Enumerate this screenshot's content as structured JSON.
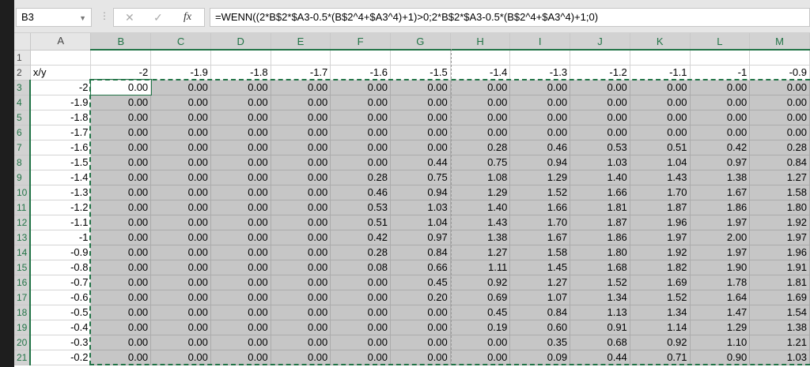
{
  "name_box": "B3",
  "formula": "=WENN((2*B$2*$A3-0.5*(B$2^4+$A3^4)+1)>0;2*B$2*$A3-0.5*(B$2^4+$A3^4)+1;0)",
  "columns": [
    "A",
    "B",
    "C",
    "D",
    "E",
    "F",
    "G",
    "H",
    "I",
    "J",
    "K",
    "L",
    "M"
  ],
  "row1": {
    "num": "1"
  },
  "row2": {
    "num": "2",
    "label": "x/y",
    "y_values": [
      "-2",
      "-1.9",
      "-1.8",
      "-1.7",
      "-1.6",
      "-1.5",
      "-1.4",
      "-1.3",
      "-1.2",
      "-1.1",
      "-1",
      "-0.9"
    ]
  },
  "rows": [
    {
      "num": "3",
      "x": "-2",
      "v": [
        "0.00",
        "0.00",
        "0.00",
        "0.00",
        "0.00",
        "0.00",
        "0.00",
        "0.00",
        "0.00",
        "0.00",
        "0.00",
        "0.00"
      ]
    },
    {
      "num": "4",
      "x": "-1.9",
      "v": [
        "0.00",
        "0.00",
        "0.00",
        "0.00",
        "0.00",
        "0.00",
        "0.00",
        "0.00",
        "0.00",
        "0.00",
        "0.00",
        "0.00"
      ]
    },
    {
      "num": "5",
      "x": "-1.8",
      "v": [
        "0.00",
        "0.00",
        "0.00",
        "0.00",
        "0.00",
        "0.00",
        "0.00",
        "0.00",
        "0.00",
        "0.00",
        "0.00",
        "0.00"
      ]
    },
    {
      "num": "6",
      "x": "-1.7",
      "v": [
        "0.00",
        "0.00",
        "0.00",
        "0.00",
        "0.00",
        "0.00",
        "0.00",
        "0.00",
        "0.00",
        "0.00",
        "0.00",
        "0.00"
      ]
    },
    {
      "num": "7",
      "x": "-1.6",
      "v": [
        "0.00",
        "0.00",
        "0.00",
        "0.00",
        "0.00",
        "0.00",
        "0.28",
        "0.46",
        "0.53",
        "0.51",
        "0.42",
        "0.28"
      ]
    },
    {
      "num": "8",
      "x": "-1.5",
      "v": [
        "0.00",
        "0.00",
        "0.00",
        "0.00",
        "0.00",
        "0.44",
        "0.75",
        "0.94",
        "1.03",
        "1.04",
        "0.97",
        "0.84"
      ]
    },
    {
      "num": "9",
      "x": "-1.4",
      "v": [
        "0.00",
        "0.00",
        "0.00",
        "0.00",
        "0.28",
        "0.75",
        "1.08",
        "1.29",
        "1.40",
        "1.43",
        "1.38",
        "1.27"
      ]
    },
    {
      "num": "10",
      "x": "-1.3",
      "v": [
        "0.00",
        "0.00",
        "0.00",
        "0.00",
        "0.46",
        "0.94",
        "1.29",
        "1.52",
        "1.66",
        "1.70",
        "1.67",
        "1.58"
      ]
    },
    {
      "num": "11",
      "x": "-1.2",
      "v": [
        "0.00",
        "0.00",
        "0.00",
        "0.00",
        "0.53",
        "1.03",
        "1.40",
        "1.66",
        "1.81",
        "1.87",
        "1.86",
        "1.80"
      ]
    },
    {
      "num": "12",
      "x": "-1.1",
      "v": [
        "0.00",
        "0.00",
        "0.00",
        "0.00",
        "0.51",
        "1.04",
        "1.43",
        "1.70",
        "1.87",
        "1.96",
        "1.97",
        "1.92"
      ]
    },
    {
      "num": "13",
      "x": "-1",
      "v": [
        "0.00",
        "0.00",
        "0.00",
        "0.00",
        "0.42",
        "0.97",
        "1.38",
        "1.67",
        "1.86",
        "1.97",
        "2.00",
        "1.97"
      ]
    },
    {
      "num": "14",
      "x": "-0.9",
      "v": [
        "0.00",
        "0.00",
        "0.00",
        "0.00",
        "0.28",
        "0.84",
        "1.27",
        "1.58",
        "1.80",
        "1.92",
        "1.97",
        "1.96"
      ]
    },
    {
      "num": "15",
      "x": "-0.8",
      "v": [
        "0.00",
        "0.00",
        "0.00",
        "0.00",
        "0.08",
        "0.66",
        "1.11",
        "1.45",
        "1.68",
        "1.82",
        "1.90",
        "1.91"
      ]
    },
    {
      "num": "16",
      "x": "-0.7",
      "v": [
        "0.00",
        "0.00",
        "0.00",
        "0.00",
        "0.00",
        "0.45",
        "0.92",
        "1.27",
        "1.52",
        "1.69",
        "1.78",
        "1.81"
      ]
    },
    {
      "num": "17",
      "x": "-0.6",
      "v": [
        "0.00",
        "0.00",
        "0.00",
        "0.00",
        "0.00",
        "0.20",
        "0.69",
        "1.07",
        "1.34",
        "1.52",
        "1.64",
        "1.69"
      ]
    },
    {
      "num": "18",
      "x": "-0.5",
      "v": [
        "0.00",
        "0.00",
        "0.00",
        "0.00",
        "0.00",
        "0.00",
        "0.45",
        "0.84",
        "1.13",
        "1.34",
        "1.47",
        "1.54"
      ]
    },
    {
      "num": "19",
      "x": "-0.4",
      "v": [
        "0.00",
        "0.00",
        "0.00",
        "0.00",
        "0.00",
        "0.00",
        "0.19",
        "0.60",
        "0.91",
        "1.14",
        "1.29",
        "1.38"
      ]
    },
    {
      "num": "20",
      "x": "-0.3",
      "v": [
        "0.00",
        "0.00",
        "0.00",
        "0.00",
        "0.00",
        "0.00",
        "0.00",
        "0.35",
        "0.68",
        "0.92",
        "1.10",
        "1.21"
      ]
    },
    {
      "num": "21",
      "x": "-0.2",
      "v": [
        "0.00",
        "0.00",
        "0.00",
        "0.00",
        "0.00",
        "0.00",
        "0.00",
        "0.09",
        "0.44",
        "0.71",
        "0.90",
        "1.03"
      ]
    }
  ]
}
